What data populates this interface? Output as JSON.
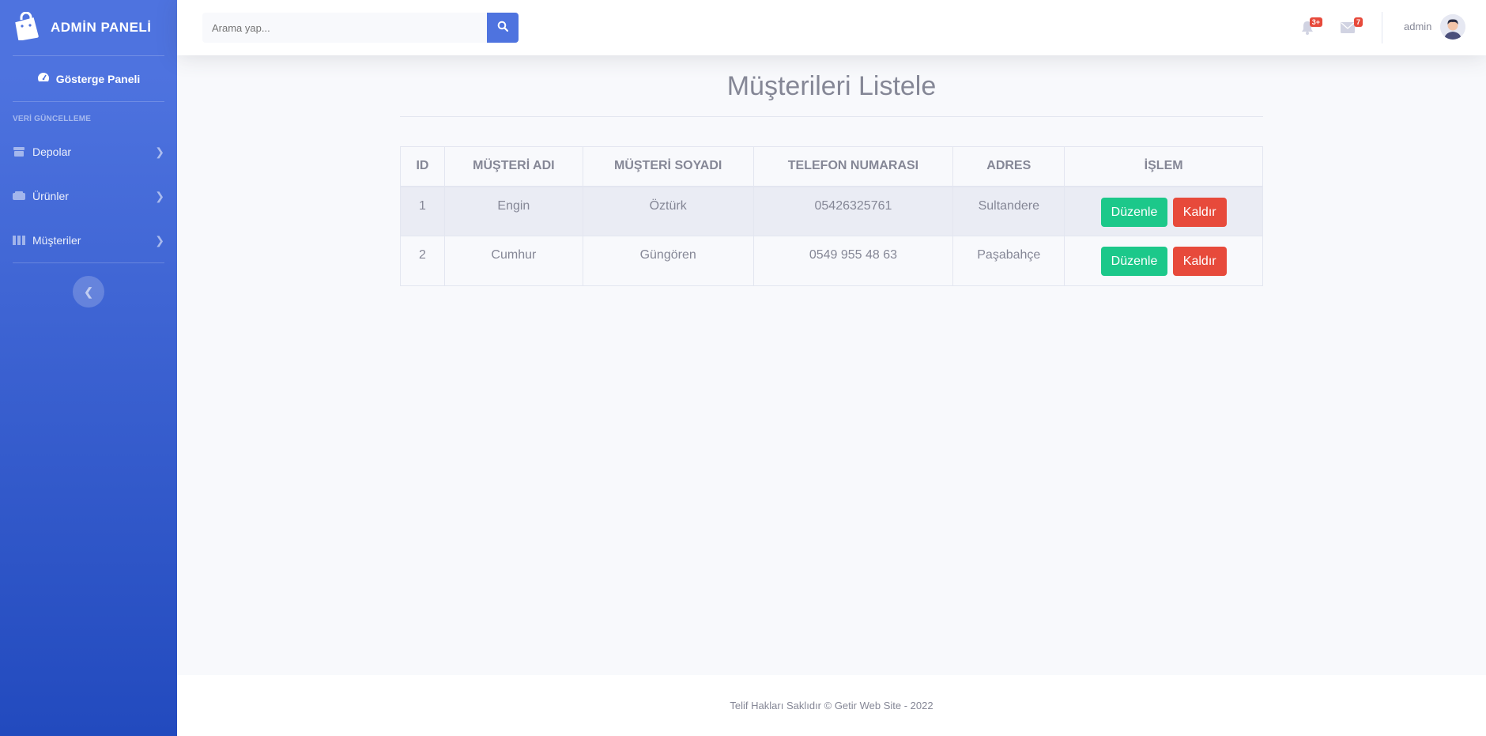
{
  "sidebar": {
    "brand": "ADMİN PANELİ",
    "dashboard": "Gösterge Paneli",
    "heading": "VERİ GÜNCELLEME",
    "items": [
      {
        "label": "Depolar",
        "icon": "warehouse-icon"
      },
      {
        "label": "Ürünler",
        "icon": "products-icon"
      },
      {
        "label": "Müşteriler",
        "icon": "customers-icon"
      }
    ]
  },
  "topbar": {
    "search_placeholder": "Arama yap...",
    "alerts_badge": "3+",
    "messages_badge": "7",
    "user": "admin"
  },
  "main": {
    "title": "Müşterileri Listele",
    "table": {
      "headers": [
        "ID",
        "MÜŞTERİ ADI",
        "MÜŞTERİ SOYADI",
        "TELEFON NUMARASI",
        "ADRES",
        "İŞLEM"
      ],
      "rows": [
        {
          "id": "1",
          "first": "Engin",
          "last": "Öztürk",
          "phone": "05426325761",
          "address": "Sultandere"
        },
        {
          "id": "2",
          "first": "Cumhur",
          "last": "Güngören",
          "phone": "0549 955 48 63",
          "address": "Paşabahçe"
        }
      ],
      "edit_label": "Düzenle",
      "delete_label": "Kaldır"
    }
  },
  "footer": {
    "text": "Telif Hakları Saklıdır © Getir Web Site - 2022"
  },
  "colors": {
    "primary": "#4e73df",
    "success": "#1cc88a",
    "danger": "#e74a3b"
  }
}
